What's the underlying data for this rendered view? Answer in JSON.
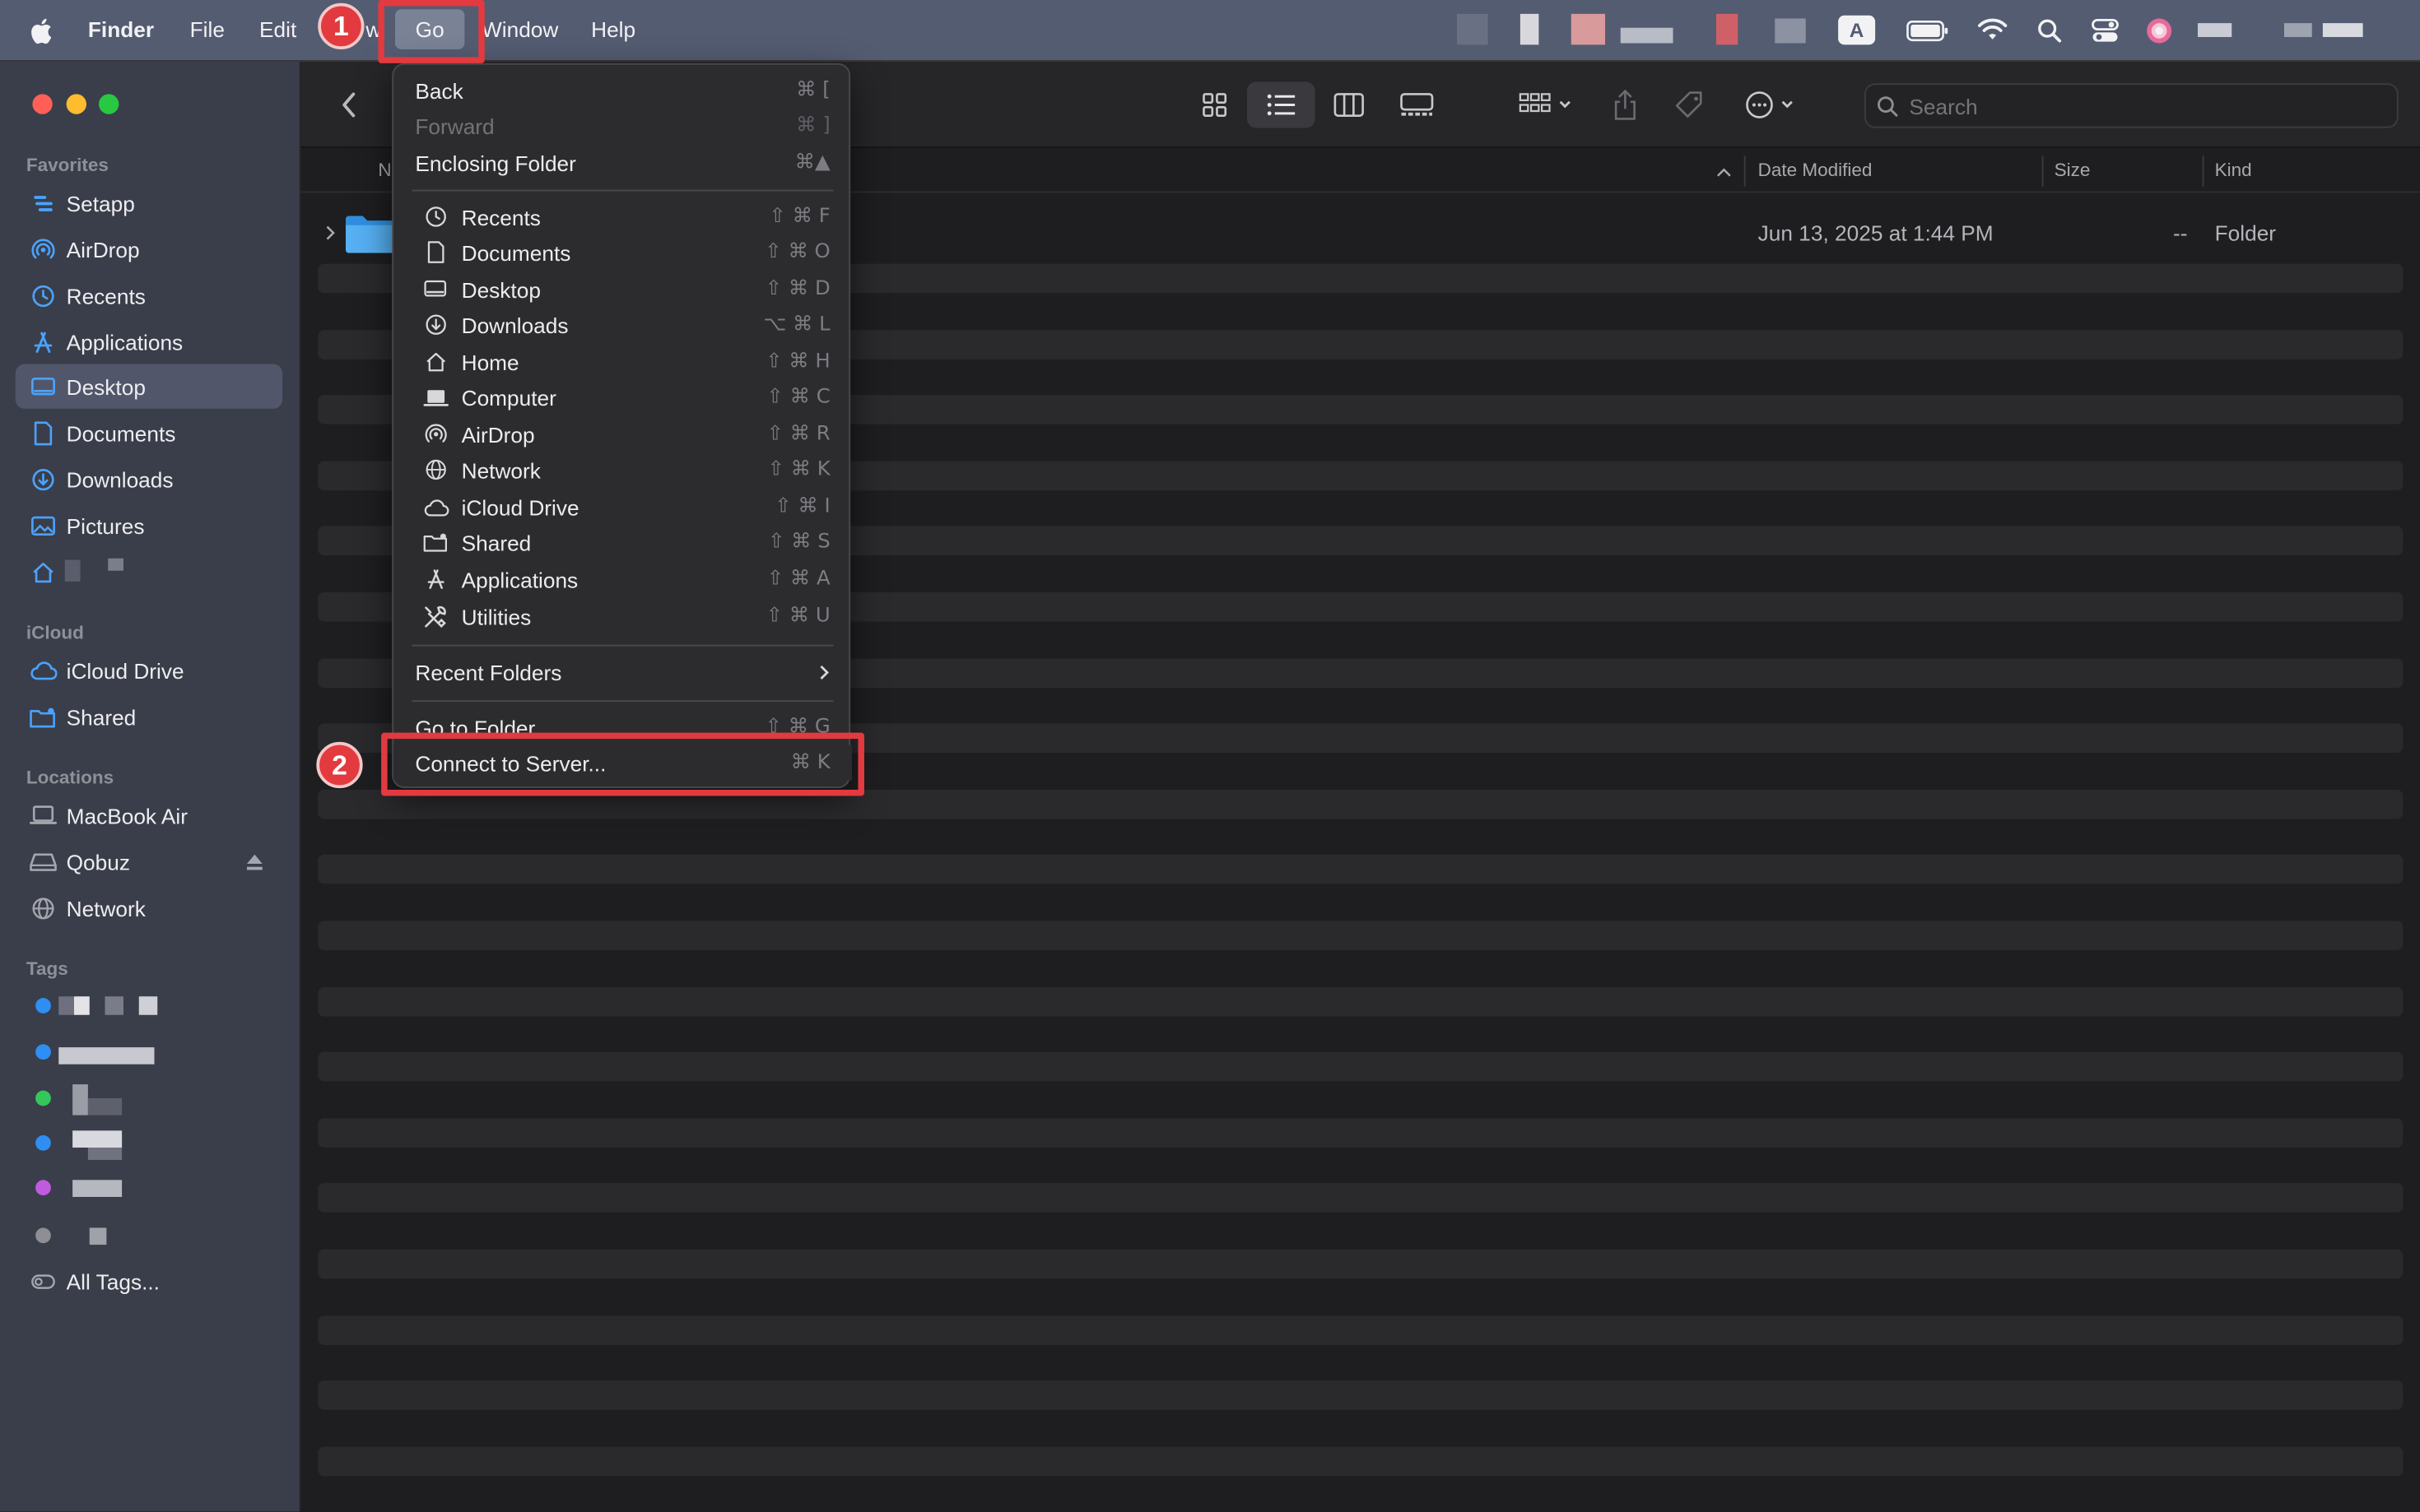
{
  "menubar": {
    "app_name": "Finder",
    "items": [
      "File",
      "Edit",
      "View",
      "Go",
      "Window",
      "Help"
    ],
    "view_partial": "w",
    "input_source": "A"
  },
  "sidebar": {
    "sections": {
      "favorites": "Favorites",
      "icloud": "iCloud",
      "locations": "Locations",
      "tags": "Tags"
    },
    "favorites": [
      "Setapp",
      "AirDrop",
      "Recents",
      "Applications",
      "Desktop",
      "Documents",
      "Downloads",
      "Pictures"
    ],
    "icloud": [
      "iCloud Drive",
      "Shared"
    ],
    "locations": [
      "MacBook Air",
      "Qobuz",
      "Network"
    ],
    "tags_all": "All Tags...",
    "tag_colors": [
      "#2f8ef4",
      "#2f8ef4",
      "#35c759",
      "#2f8ef4",
      "#c05be0",
      "#8e8e93"
    ],
    "selected": "Desktop"
  },
  "toolbar": {
    "search_placeholder": "Search"
  },
  "columns": {
    "name_partial": "N",
    "date": "Date Modified",
    "size": "Size",
    "kind": "Kind"
  },
  "rows": [
    {
      "date": "Jun 13, 2025 at 1:44 PM",
      "size": "--",
      "kind": "Folder"
    }
  ],
  "go_menu": {
    "back": {
      "label": "Back",
      "shortcut": "⌘ ["
    },
    "forward": {
      "label": "Forward",
      "shortcut": "⌘ ]"
    },
    "enclosing": {
      "label": "Enclosing Folder",
      "shortcut": "⌘▲"
    },
    "places": [
      {
        "label": "Recents",
        "shortcut": "⇧ ⌘ F",
        "icon": "clock-icon"
      },
      {
        "label": "Documents",
        "shortcut": "⇧ ⌘ O",
        "icon": "document-icon"
      },
      {
        "label": "Desktop",
        "shortcut": "⇧ ⌘ D",
        "icon": "desktop-icon"
      },
      {
        "label": "Downloads",
        "shortcut": "⌥ ⌘ L",
        "icon": "download-icon"
      },
      {
        "label": "Home",
        "shortcut": "⇧ ⌘ H",
        "icon": "home-icon"
      },
      {
        "label": "Computer",
        "shortcut": "⇧ ⌘ C",
        "icon": "laptop-icon"
      },
      {
        "label": "AirDrop",
        "shortcut": "⇧ ⌘ R",
        "icon": "airdrop-icon"
      },
      {
        "label": "Network",
        "shortcut": "⇧ ⌘ K",
        "icon": "globe-icon"
      },
      {
        "label": "iCloud Drive",
        "shortcut": "⇧ ⌘ I",
        "icon": "cloud-icon"
      },
      {
        "label": "Shared",
        "shortcut": "⇧ ⌘ S",
        "icon": "shared-folder-icon"
      },
      {
        "label": "Applications",
        "shortcut": "⇧ ⌘ A",
        "icon": "applications-icon"
      },
      {
        "label": "Utilities",
        "shortcut": "⇧ ⌘ U",
        "icon": "utilities-icon"
      }
    ],
    "recent_folders": "Recent Folders",
    "go_to_folder": {
      "label": "Go to Folder...",
      "shortcut": "⇧ ⌘ G"
    },
    "connect": {
      "label": "Connect to Server...",
      "shortcut": "⌘ K"
    }
  },
  "annotations": {
    "step1": "1",
    "step2": "2",
    "color": "#e23a3f"
  }
}
